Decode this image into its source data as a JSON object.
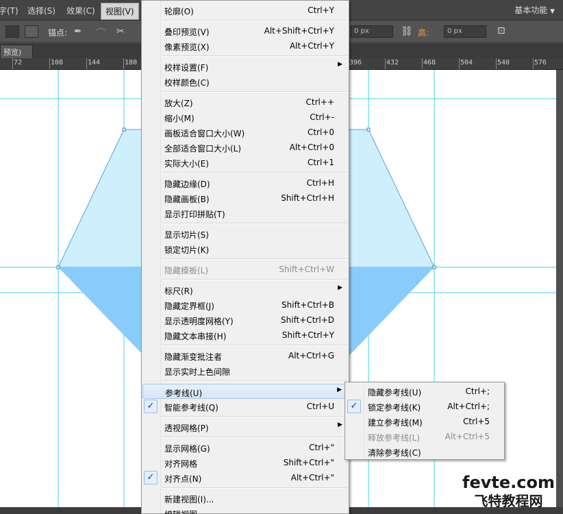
{
  "menubar": {
    "items": [
      "字(T)",
      "选择(S)",
      "效果(C)",
      "视图(V)"
    ],
    "workspace": "基本功能"
  },
  "control_bar": {
    "anchor_label": "锚点:",
    "field_w": "0 px",
    "height_label": "高:",
    "field_h": "0 px"
  },
  "tab": {
    "title": "预览)",
    "close": "×"
  },
  "ruler": {
    "ticks": [
      "72",
      "108",
      "144",
      "180",
      "396",
      "432",
      "468",
      "504",
      "540",
      "576"
    ]
  },
  "view_menu": {
    "items": [
      {
        "label": "轮廓(O)",
        "shortcut": "Ctrl+Y"
      },
      {
        "sep": true
      },
      {
        "label": "叠印预览(V)",
        "shortcut": "Alt+Shift+Ctrl+Y"
      },
      {
        "label": "像素预览(X)",
        "shortcut": "Alt+Ctrl+Y"
      },
      {
        "sep": true
      },
      {
        "label": "校样设置(F)",
        "submenu": true
      },
      {
        "label": "校样颜色(C)"
      },
      {
        "sep": true
      },
      {
        "label": "放大(Z)",
        "shortcut": "Ctrl++"
      },
      {
        "label": "缩小(M)",
        "shortcut": "Ctrl+-"
      },
      {
        "label": "画板适合窗口大小(W)",
        "shortcut": "Ctrl+0"
      },
      {
        "label": "全部适合窗口大小(L)",
        "shortcut": "Alt+Ctrl+0"
      },
      {
        "label": "实际大小(E)",
        "shortcut": "Ctrl+1"
      },
      {
        "sep": true
      },
      {
        "label": "隐藏边缘(D)",
        "shortcut": "Ctrl+H"
      },
      {
        "label": "隐藏画板(B)",
        "shortcut": "Shift+Ctrl+H"
      },
      {
        "label": "显示打印拼贴(T)"
      },
      {
        "sep": true
      },
      {
        "label": "显示切片(S)"
      },
      {
        "label": "锁定切片(K)"
      },
      {
        "sep": true
      },
      {
        "label": "隐藏模板(L)",
        "shortcut": "Shift+Ctrl+W",
        "disabled": true
      },
      {
        "sep": true
      },
      {
        "label": "标尺(R)",
        "submenu": true
      },
      {
        "label": "隐藏定界框(J)",
        "shortcut": "Shift+Ctrl+B"
      },
      {
        "label": "显示透明度网格(Y)",
        "shortcut": "Shift+Ctrl+D"
      },
      {
        "label": "隐藏文本串接(H)",
        "shortcut": "Shift+Ctrl+Y"
      },
      {
        "sep": true
      },
      {
        "label": "隐藏渐变批注者",
        "shortcut": "Alt+Ctrl+G"
      },
      {
        "label": "显示实时上色间隙"
      },
      {
        "sep": true
      },
      {
        "label": "参考线(U)",
        "submenu": true,
        "highlighted": true
      },
      {
        "label": "智能参考线(Q)",
        "shortcut": "Ctrl+U",
        "checked": true
      },
      {
        "sep": true
      },
      {
        "label": "透视网格(P)",
        "submenu": true
      },
      {
        "sep": true
      },
      {
        "label": "显示网格(G)",
        "shortcut": "Ctrl+\""
      },
      {
        "label": "对齐网格",
        "shortcut": "Shift+Ctrl+\""
      },
      {
        "label": "对齐点(N)",
        "shortcut": "Alt+Ctrl+\"",
        "checked": true
      },
      {
        "sep": true
      },
      {
        "label": "新建视图(I)..."
      },
      {
        "label": "编辑视图..."
      }
    ]
  },
  "guides_submenu": {
    "items": [
      {
        "label": "隐藏参考线(U)",
        "shortcut": "Ctrl+;"
      },
      {
        "label": "锁定参考线(K)",
        "shortcut": "Alt+Ctrl+;",
        "checked": true
      },
      {
        "label": "建立参考线(M)",
        "shortcut": "Ctrl+5"
      },
      {
        "label": "释放参考线(L)",
        "shortcut": "Alt+Ctrl+5",
        "disabled": true
      },
      {
        "label": "清除参考线(C)"
      }
    ]
  },
  "watermark": {
    "en": "fevte.com",
    "cn": "飞特教程网"
  },
  "colors": {
    "guide": "#3fd6e8",
    "shape_top": "#cdf0fc",
    "shape_bottom": "#89ccfb",
    "selection": "#3b78d8"
  }
}
